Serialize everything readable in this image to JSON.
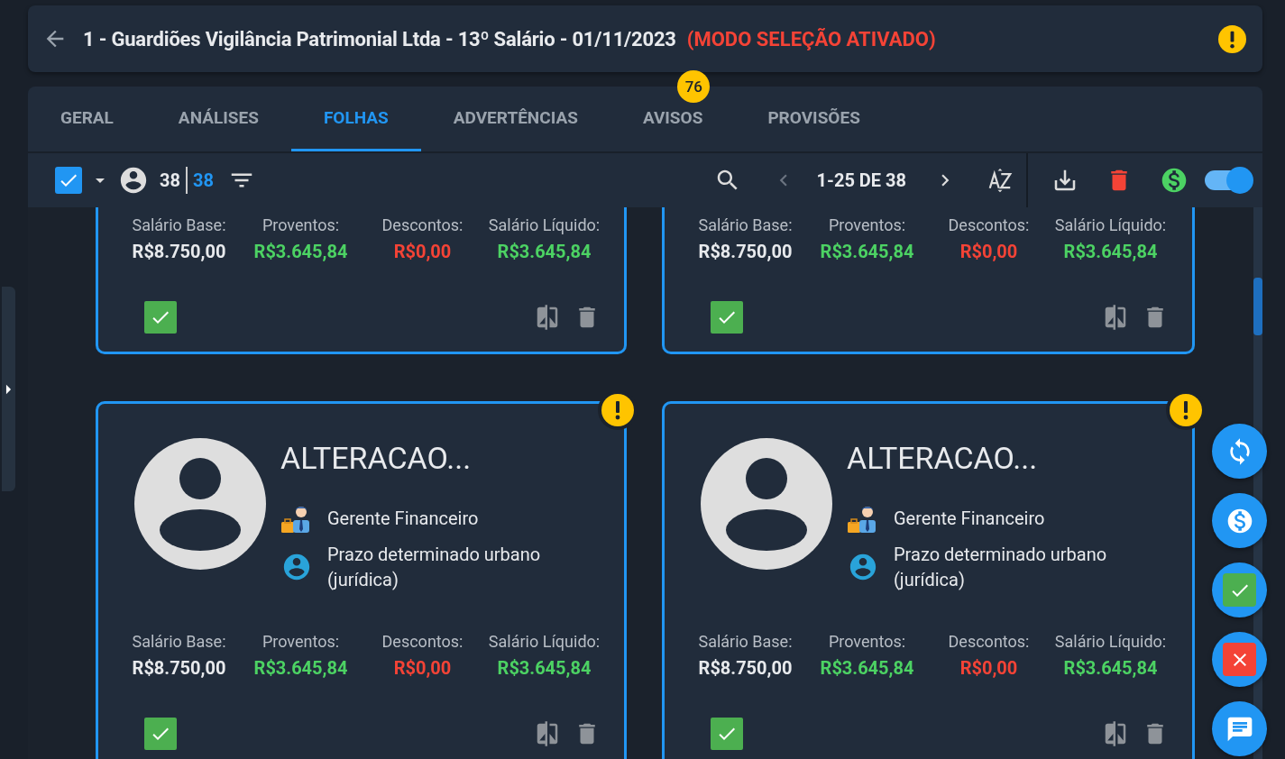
{
  "header": {
    "title": "1 - Guardiões Vigilância Patrimonial Ltda - 13º Salário - 01/11/2023",
    "mode": "(MODO SELEÇÃO ATIVADO)",
    "warning": true
  },
  "tabs": [
    {
      "label": "GERAL",
      "selected": false
    },
    {
      "label": "ANÁLISES",
      "selected": false
    },
    {
      "label": "FOLHAS",
      "selected": true
    },
    {
      "label": "ADVERTÊNCIAS",
      "selected": false
    },
    {
      "label": "AVISOS",
      "selected": false,
      "badge": "76"
    },
    {
      "label": "PROVISÕES",
      "selected": false
    }
  ],
  "toolbar": {
    "select_all": {
      "checked": true
    },
    "count_total": "38",
    "count_selected": "38",
    "pagination": "1-25 DE 38",
    "prev": {
      "disabled": true
    },
    "next": {
      "disabled": false
    },
    "switch": {
      "on": true
    }
  },
  "cards": [
    {
      "warning": false,
      "checked": true,
      "salary": [
        {
          "label": "Salário Base:",
          "value": "R$8.750,00",
          "kind": "neutral"
        },
        {
          "label": "Proventos:",
          "value": "R$3.645,84",
          "kind": "positive"
        },
        {
          "label": "Descontos:",
          "value": "R$0,00",
          "kind": "negative"
        },
        {
          "label": "Salário Líquido:",
          "value": "R$3.645,84",
          "kind": "positive"
        }
      ]
    },
    {
      "warning": false,
      "checked": true,
      "salary": [
        {
          "label": "Salário Base:",
          "value": "R$8.750,00",
          "kind": "neutral"
        },
        {
          "label": "Proventos:",
          "value": "R$3.645,84",
          "kind": "positive"
        },
        {
          "label": "Descontos:",
          "value": "R$0,00",
          "kind": "negative"
        },
        {
          "label": "Salário Líquido:",
          "value": "R$3.645,84",
          "kind": "positive"
        }
      ]
    },
    {
      "name": "ALTERACAO...",
      "role": "Gerente Financeiro",
      "contract": "Prazo determinado urbano (jurídica)",
      "warning": true,
      "checked": true,
      "salary": [
        {
          "label": "Salário Base:",
          "value": "R$8.750,00",
          "kind": "neutral"
        },
        {
          "label": "Proventos:",
          "value": "R$3.645,84",
          "kind": "positive"
        },
        {
          "label": "Descontos:",
          "value": "R$0,00",
          "kind": "negative"
        },
        {
          "label": "Salário Líquido:",
          "value": "R$3.645,84",
          "kind": "positive"
        }
      ]
    },
    {
      "name": "ALTERACAO...",
      "role": "Gerente Financeiro",
      "contract": "Prazo determinado urbano (jurídica)",
      "warning": true,
      "checked": true,
      "salary": [
        {
          "label": "Salário Base:",
          "value": "R$8.750,00",
          "kind": "neutral"
        },
        {
          "label": "Proventos:",
          "value": "R$3.645,84",
          "kind": "positive"
        },
        {
          "label": "Descontos:",
          "value": "R$0,00",
          "kind": "negative"
        },
        {
          "label": "Salário Líquido:",
          "value": "R$3.645,84",
          "kind": "positive"
        }
      ]
    }
  ],
  "fab_buttons": [
    {
      "kind": "refresh"
    },
    {
      "kind": "money"
    },
    {
      "kind": "approve"
    },
    {
      "kind": "reject"
    },
    {
      "kind": "chat"
    }
  ]
}
